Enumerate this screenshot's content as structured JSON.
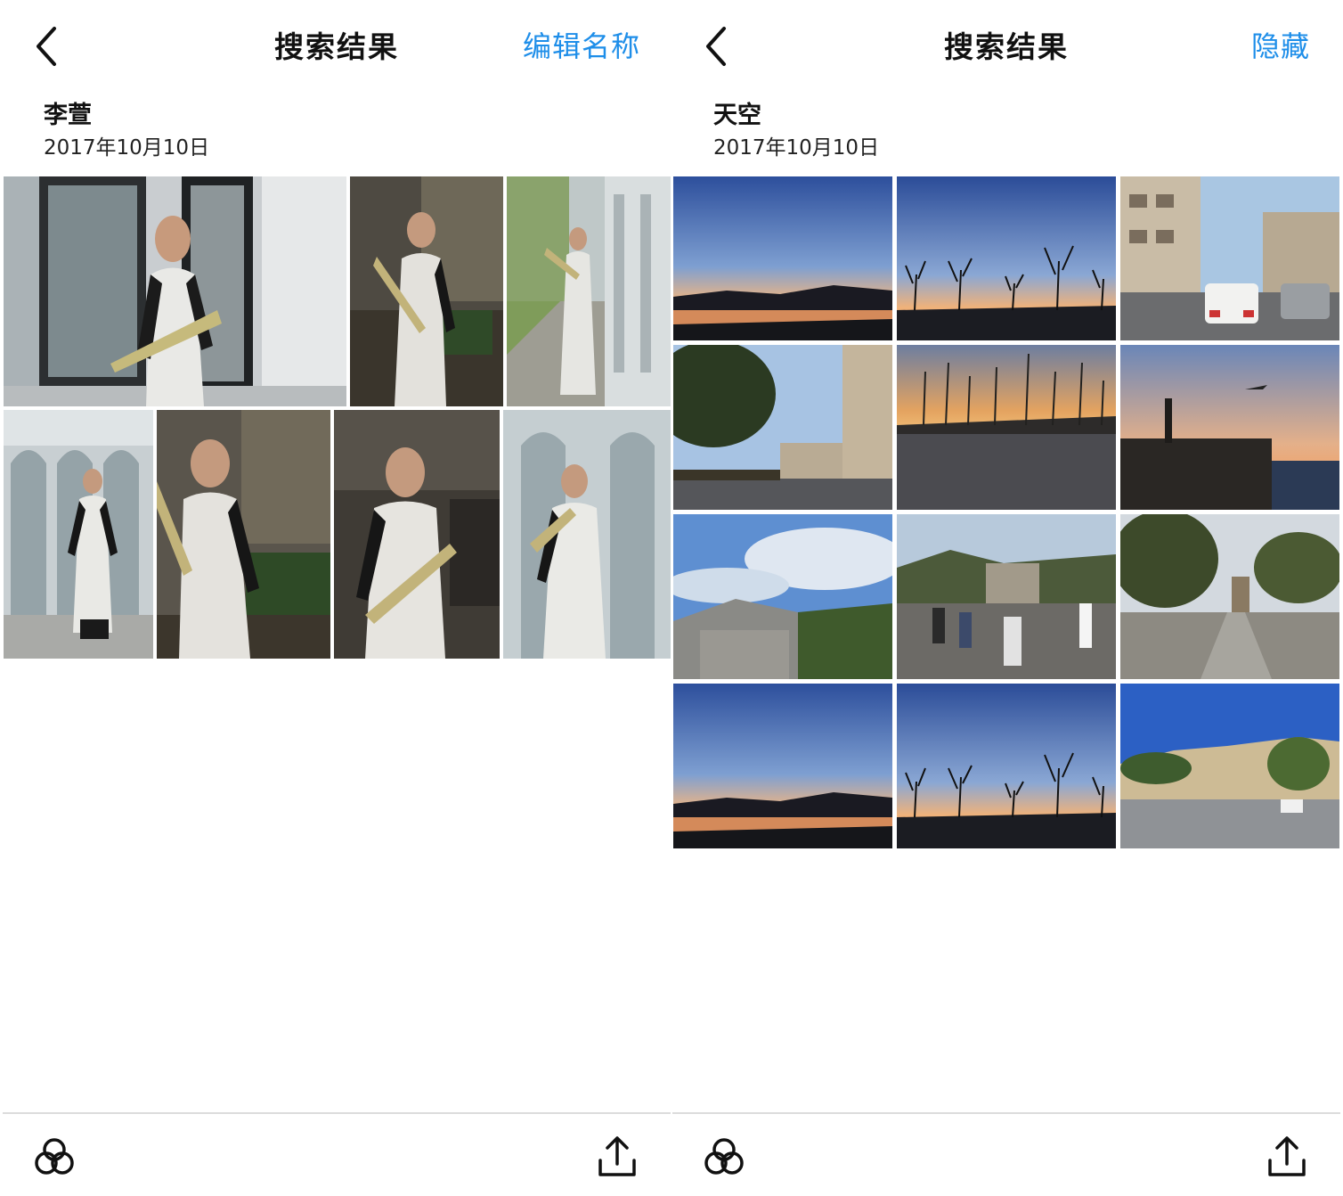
{
  "screens": [
    {
      "nav": {
        "title": "搜索结果",
        "action_label": "编辑名称"
      },
      "album": {
        "name": "李萱",
        "date": "2017年10月10日"
      }
    },
    {
      "nav": {
        "title": "搜索结果",
        "action_label": "隐藏"
      },
      "album": {
        "name": "天空",
        "date": "2017年10月10日"
      }
    }
  ],
  "colors": {
    "accent": "#1e8ee9",
    "title": "#111111",
    "divider": "#dcdcdc",
    "background": "#ffffff"
  },
  "icons": {
    "back": "chevron-left-icon",
    "toolbar_left": "filter-circles-icon",
    "toolbar_right": "share-icon"
  }
}
